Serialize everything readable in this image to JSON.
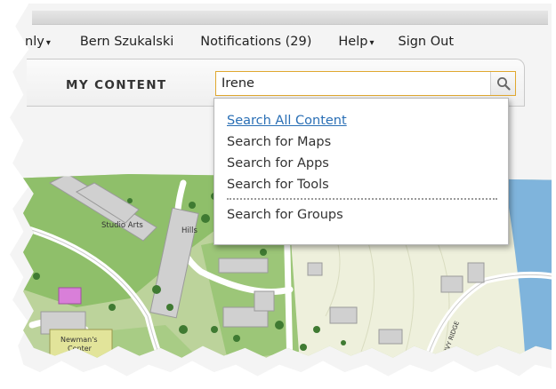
{
  "nav": {
    "items": [
      {
        "label": "nly",
        "caret": "▾"
      },
      {
        "label": "Bern Szukalski",
        "caret": ""
      },
      {
        "label": "Notifications (29)",
        "caret": ""
      },
      {
        "label": "Help",
        "caret": "▾"
      },
      {
        "label": "Sign Out",
        "caret": ""
      }
    ]
  },
  "content_bar": {
    "title": "MY CONTENT"
  },
  "search": {
    "value": "Irene",
    "icon": "search-icon"
  },
  "dropdown": {
    "items": [
      {
        "label": "Search All Content",
        "active": true
      },
      {
        "label": "Search for Maps",
        "active": false
      },
      {
        "label": "Search for Apps",
        "active": false
      },
      {
        "label": "Search for Tools",
        "active": false
      }
    ],
    "after_separator": {
      "label": "Search for Groups"
    }
  },
  "map": {
    "labels": {
      "studio_arts": "Studio Arts",
      "hills": "Hills",
      "newmans_line1": "Newman's",
      "newmans_line2": "Center",
      "ivy_ridge": "IVY RIDGE"
    }
  },
  "colors": {
    "search_border": "#e0a830",
    "link_active": "#2a6fb5"
  }
}
